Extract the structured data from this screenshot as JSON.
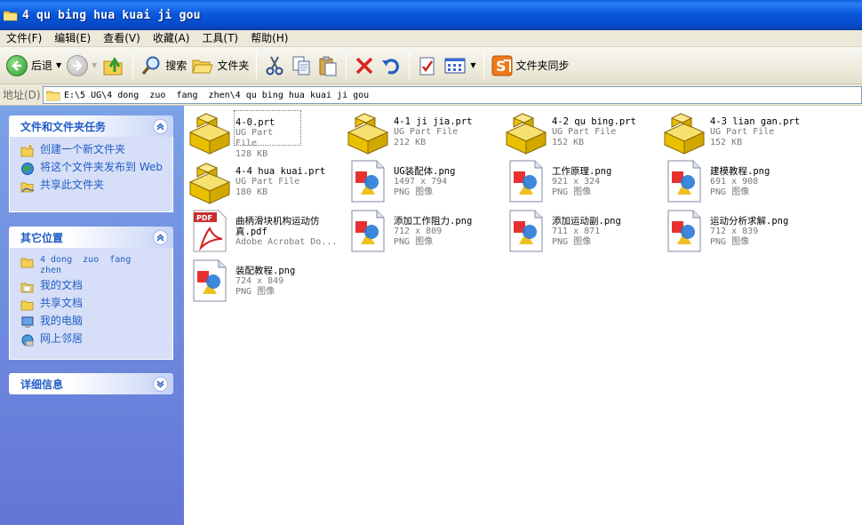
{
  "window": {
    "title": "4 qu bing hua kuai ji gou",
    "icon": "folder-icon"
  },
  "menu": [
    {
      "label": "文件(F)"
    },
    {
      "label": "编辑(E)"
    },
    {
      "label": "查看(V)"
    },
    {
      "label": "收藏(A)"
    },
    {
      "label": "工具(T)"
    },
    {
      "label": "帮助(H)"
    }
  ],
  "toolbar": {
    "back_label": "后退",
    "search_label": "搜索",
    "folders_label": "文件夹",
    "sync_label": "文件夹同步"
  },
  "address": {
    "label": "地址(D)",
    "path": "E:\\5 UG\\4 dong  zuo  fang  zhen\\4 qu bing hua kuai ji gou"
  },
  "sidebar": {
    "tasks": {
      "title": "文件和文件夹任务",
      "items": [
        {
          "label": "创建一个新文件夹",
          "icon": "new-folder-icon"
        },
        {
          "label": "将这个文件夹发布到 Web",
          "icon": "publish-web-icon"
        },
        {
          "label": "共享此文件夹",
          "icon": "share-folder-icon"
        }
      ]
    },
    "places": {
      "title": "其它位置",
      "items": [
        {
          "label": "4 dong  zuo  fang zhen",
          "icon": "folder-icon"
        },
        {
          "label": "我的文档",
          "icon": "my-documents-icon"
        },
        {
          "label": "共享文档",
          "icon": "shared-documents-icon"
        },
        {
          "label": "我的电脑",
          "icon": "my-computer-icon"
        },
        {
          "label": "网上邻居",
          "icon": "network-places-icon"
        }
      ]
    },
    "details": {
      "title": "详细信息"
    }
  },
  "files": [
    {
      "name": "4-0.prt",
      "line2": "UG Part File",
      "line3": "128 KB",
      "type": "prt"
    },
    {
      "name": "4-1 ji jia.prt",
      "line2": "UG Part File",
      "line3": "212 KB",
      "type": "prt"
    },
    {
      "name": "4-2 qu bing.prt",
      "line2": "UG Part File",
      "line3": "152 KB",
      "type": "prt"
    },
    {
      "name": "4-3 lian gan.prt",
      "line2": "UG Part File",
      "line3": "152 KB",
      "type": "prt"
    },
    {
      "name": "4-4 hua kuai.prt",
      "line2": "UG Part File",
      "line3": "180 KB",
      "type": "prt"
    },
    {
      "name": "UG装配体.png",
      "line2": "1497 x 794",
      "line3": "PNG 图像",
      "type": "png"
    },
    {
      "name": "工作原理.png",
      "line2": "921 x 324",
      "line3": "PNG 图像",
      "type": "png"
    },
    {
      "name": "建模教程.png",
      "line2": "691 x 908",
      "line3": "PNG 图像",
      "type": "png"
    },
    {
      "name": "曲柄滑块机构运动仿真.pdf",
      "line2": "Adobe Acrobat Do...",
      "line3": "",
      "type": "pdf"
    },
    {
      "name": "添加工作阻力.png",
      "line2": "712 x 809",
      "line3": "PNG 图像",
      "type": "png"
    },
    {
      "name": "添加运动副.png",
      "line2": "711 x 871",
      "line3": "PNG 图像",
      "type": "png"
    },
    {
      "name": "运动分析求解.png",
      "line2": "712 x 839",
      "line3": "PNG 图像",
      "type": "png"
    },
    {
      "name": "装配教程.png",
      "line2": "724 x 849",
      "line3": "PNG 图像",
      "type": "png"
    }
  ],
  "colors": {
    "accent": "#215dc6",
    "titlebar": "#0a58dd",
    "panel_bg": "#d6dff7"
  }
}
